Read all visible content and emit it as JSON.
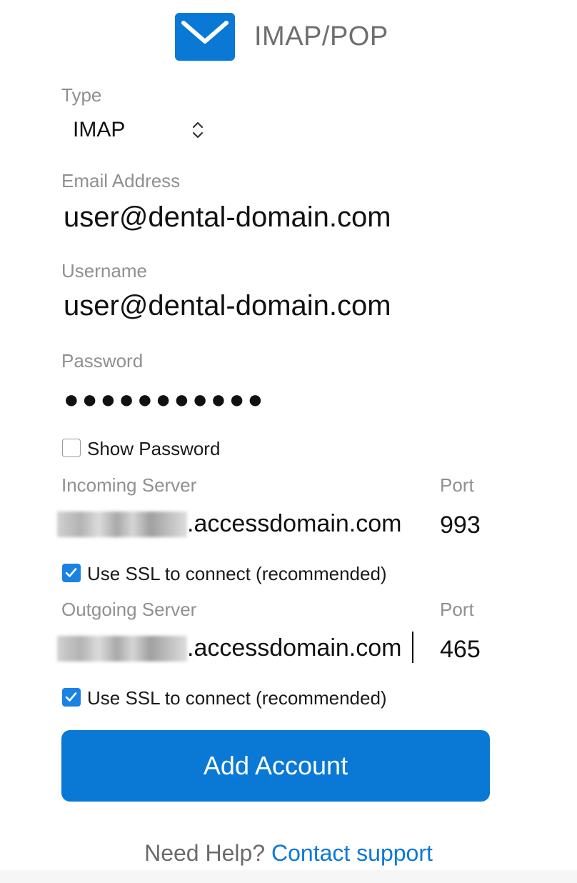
{
  "header": {
    "title": "IMAP/POP",
    "icon": "envelope-icon",
    "icon_color": "#0a79d6"
  },
  "type": {
    "label": "Type",
    "value": "IMAP",
    "icon": "up-down-chevron-icon"
  },
  "email": {
    "label": "Email Address",
    "value": "user@dental-domain.com"
  },
  "username": {
    "label": "Username",
    "value": "user@dental-domain.com"
  },
  "password": {
    "label": "Password",
    "value": "●●●●●●●●●●●"
  },
  "show_password": {
    "label": "Show Password",
    "checked": false
  },
  "incoming": {
    "label": "Incoming Server",
    "server_suffix": ".accessdomain.com",
    "port_label": "Port",
    "port": "993",
    "ssl_label": "Use SSL to connect (recommended)",
    "ssl_checked": true
  },
  "outgoing": {
    "label": "Outgoing Server",
    "server_suffix": ".accessdomain.com",
    "port_label": "Port",
    "port": "465",
    "ssl_label": "Use SSL to connect (recommended)",
    "ssl_checked": true
  },
  "actions": {
    "add_account": "Add Account"
  },
  "help": {
    "prefix": "Need Help?",
    "link": "Contact support"
  },
  "colors": {
    "accent": "#0a79d6",
    "checkbox": "#1a82e3",
    "label": "#909090"
  }
}
